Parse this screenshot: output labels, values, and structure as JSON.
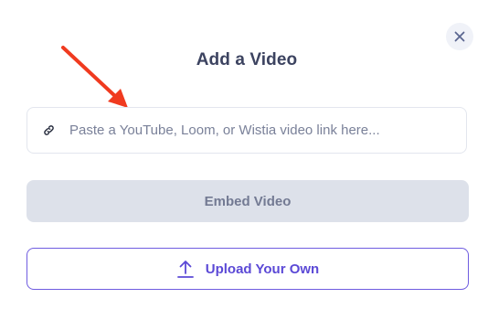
{
  "dialog": {
    "title": "Add a Video",
    "close_icon": "close-icon"
  },
  "url_input": {
    "icon": "link-icon",
    "value": "",
    "placeholder": "Paste a YouTube, Loom, or Wistia video link here..."
  },
  "embed_button": {
    "label": "Embed Video",
    "disabled": true
  },
  "upload_button": {
    "icon": "upload-icon",
    "label": "Upload Your Own"
  },
  "annotation": {
    "icon": "red-arrow-icon",
    "color": "#f03a1f"
  },
  "colors": {
    "accent": "#5b49d6",
    "title": "#3c4360",
    "disabled_bg": "#dde1ea",
    "disabled_text": "#737a93"
  }
}
